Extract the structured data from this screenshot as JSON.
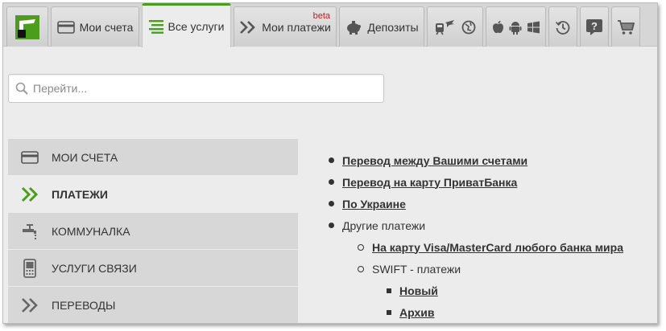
{
  "nav": {
    "my_accounts": "Мои счета",
    "all_services": "Все услуги",
    "my_payments": "Мои платежи",
    "my_payments_badge": "beta",
    "deposits": "Депозиты"
  },
  "search": {
    "placeholder": "Перейти..."
  },
  "menu": {
    "items": [
      {
        "label": "МОИ СЧЕТА",
        "icon": "card-icon"
      },
      {
        "label": "ПЛАТЕЖИ",
        "icon": "double-chevron-icon"
      },
      {
        "label": "КОММУНАЛКА",
        "icon": "faucet-icon"
      },
      {
        "label": "УСЛУГИ СВЯЗИ",
        "icon": "mobile-phone-icon"
      },
      {
        "label": "ПЕРЕВОДЫ",
        "icon": "double-chevron-icon"
      }
    ]
  },
  "content": {
    "between_accounts": "Перевод между Вашими счетами",
    "to_privat_card": "Перевод на карту ПриватБанка",
    "ukraine": "По Украине",
    "other_payments": "Другие платежи",
    "visa_mastercard": "На карту Visa/MasterCard любого банка мира",
    "swift": "SWIFT - платежи",
    "new": "Новый",
    "archive": "Архив"
  },
  "colors": {
    "accent": "#4a9d1d",
    "badge": "#c21d1d"
  }
}
